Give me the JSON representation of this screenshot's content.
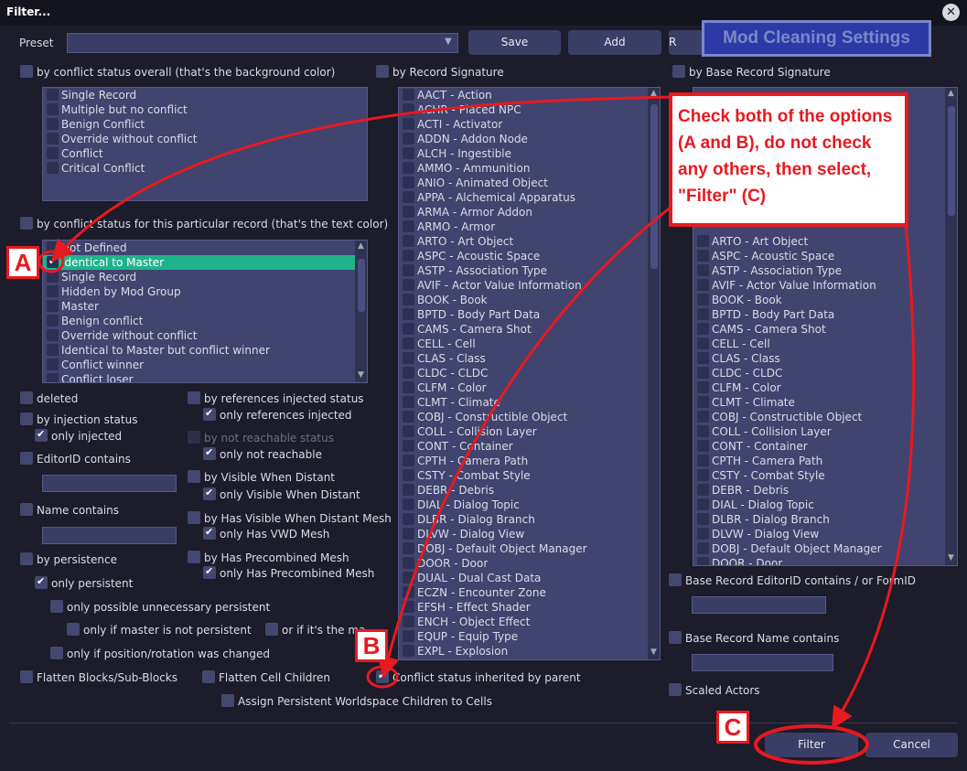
{
  "window": {
    "title": "Filter..."
  },
  "preset": {
    "label": "Preset",
    "value": ""
  },
  "buttons": {
    "save": "Save",
    "add": "Add",
    "remove": "R",
    "filter": "Filter",
    "cancel": "Cancel"
  },
  "overlay": {
    "title": "Mod Cleaning Settings",
    "instruction": "Check both of the options (A and B), do not check any others, then select, \"Filter\" (C)",
    "marker_a": "A",
    "marker_b": "B",
    "marker_c": "C"
  },
  "conflict_overall": {
    "label": "by conflict status overall (that's the background color)",
    "items": [
      "Single Record",
      "Multiple but no conflict",
      "Benign Conflict",
      "Override without conflict",
      "Conflict",
      "Critical Conflict"
    ]
  },
  "conflict_particular": {
    "label": "by conflict status for this particular record  (that's the text color)",
    "items": [
      {
        "label": "Not Defined",
        "checked": false,
        "selected": false
      },
      {
        "label": "Identical to Master",
        "checked": true,
        "selected": true
      },
      {
        "label": "Single Record",
        "checked": false,
        "selected": false
      },
      {
        "label": "Hidden by Mod Group",
        "checked": false,
        "selected": false
      },
      {
        "label": "Master",
        "checked": false,
        "selected": false
      },
      {
        "label": "Benign conflict",
        "checked": false,
        "selected": false
      },
      {
        "label": "Override without conflict",
        "checked": false,
        "selected": false
      },
      {
        "label": "Identical to Master but conflict winner",
        "checked": false,
        "selected": false
      },
      {
        "label": "Conflict winner",
        "checked": false,
        "selected": false
      },
      {
        "label": "Conflict loser",
        "checked": false,
        "selected": false
      }
    ]
  },
  "options": {
    "deleted": "deleted",
    "injection_status": "by injection status",
    "only_injected": "only injected",
    "editorid_contains": "EditorID contains",
    "name_contains": "Name contains",
    "persistence": "by persistence",
    "only_persistent": "only persistent",
    "only_possible_unnecessary": "only possible unnecessary persistent",
    "only_if_master_not_persistent": "only if master is not persistent",
    "or_if_its_the_master": "or if it's the ma",
    "only_if_position_changed": "only if position/rotation was changed",
    "flatten_blocks": "Flatten Blocks/Sub-Blocks",
    "flatten_cell_children": "Flatten Cell Children",
    "conflict_inherited": "Conflict status inherited by parent",
    "assign_persistent": "Assign Persistent Worldspace Children to Cells",
    "refs_injected_status": "by references injected status",
    "only_refs_injected": "only references injected",
    "not_reachable_status": "by not reachable status",
    "only_not_reachable": "only not reachable",
    "visible_when_distant": "by Visible When Distant",
    "only_visible_when_distant": "only Visible When Distant",
    "has_vwd_mesh": "by Has Visible When Distant Mesh",
    "only_has_vwd_mesh": "only Has VWD Mesh",
    "has_precombined": "by Has Precombined Mesh",
    "only_has_precombined": "only Has Precombined Mesh"
  },
  "record_signature": {
    "label": "by Record Signature",
    "items": [
      "AACT - Action",
      "ACHR - Placed NPC",
      "ACTI - Activator",
      "ADDN - Addon Node",
      "ALCH - Ingestible",
      "AMMO - Ammunition",
      "ANIO - Animated Object",
      "APPA - Alchemical Apparatus",
      "ARMA - Armor Addon",
      "ARMO - Armor",
      "ARTO - Art Object",
      "ASPC - Acoustic Space",
      "ASTP - Association Type",
      "AVIF - Actor Value Information",
      "BOOK - Book",
      "BPTD - Body Part Data",
      "CAMS - Camera Shot",
      "CELL - Cell",
      "CLAS - Class",
      "CLDC - CLDC",
      "CLFM - Color",
      "CLMT - Climate",
      "COBJ - Constructible Object",
      "COLL - Collision Layer",
      "CONT - Container",
      "CPTH - Camera Path",
      "CSTY - Combat Style",
      "DEBR - Debris",
      "DIAL - Dialog Topic",
      "DLBR - Dialog Branch",
      "DLVW - Dialog View",
      "DOBJ - Default Object Manager",
      "DOOR - Door",
      "DUAL - Dual Cast Data",
      "ECZN - Encounter Zone",
      "EFSH - Effect Shader",
      "ENCH - Object Effect",
      "EQUP - Equip Type",
      "EXPL - Explosion"
    ]
  },
  "base_signature": {
    "label": "by Base Record Signature",
    "items": [
      "ARTO - Art Object",
      "ASPC - Acoustic Space",
      "ASTP - Association Type",
      "AVIF - Actor Value Information",
      "BOOK - Book",
      "BPTD - Body Part Data",
      "CAMS - Camera Shot",
      "CELL - Cell",
      "CLAS - Class",
      "CLDC - CLDC",
      "CLFM - Color",
      "CLMT - Climate",
      "COBJ - Constructible Object",
      "COLL - Collision Layer",
      "CONT - Container",
      "CPTH - Camera Path",
      "CSTY - Combat Style",
      "DEBR - Debris",
      "DIAL - Dialog Topic",
      "DLBR - Dialog Branch",
      "DLVW - Dialog View",
      "DOBJ - Default Object Manager",
      "DOOR - Door"
    ]
  },
  "base_fields": {
    "editorid": "Base Record EditorID contains / or FormID",
    "name": "Base Record Name contains",
    "scaled_actors": "Scaled Actors"
  },
  "colors": {
    "accent_selected": "#20b38b",
    "annotation_red": "#e8191f",
    "background": "#1c1c2a",
    "list_bg": "#40446e"
  }
}
